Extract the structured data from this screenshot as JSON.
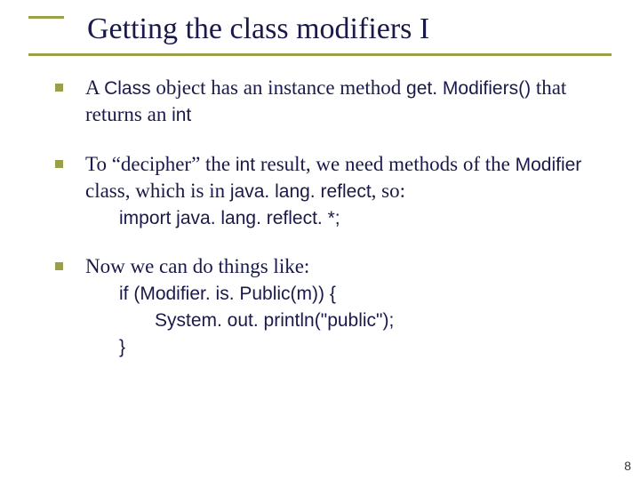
{
  "title": "Getting the class modifiers I",
  "page": "8",
  "accent_color": "#9aa04a",
  "items": [
    {
      "t0": "A ",
      "t1": "Class",
      "t2": " object has an instance method ",
      "t3": "get. Modifiers()",
      "t4": " that returns an ",
      "t5": "int"
    },
    {
      "t0": "To “decipher” the ",
      "t1": "int",
      "t2": " result, we need methods of the ",
      "t3": "Modifier",
      "t4": " class, which is in ",
      "t5": "java. lang. reflect",
      "t6": ", so:",
      "code0": "import java. lang. reflect. *;"
    },
    {
      "t0": "Now we can do things like:",
      "code0": "if (Modifier. is. Public(m)) {",
      "code1": "System. out. println(\"public\");",
      "code2": "}"
    }
  ]
}
